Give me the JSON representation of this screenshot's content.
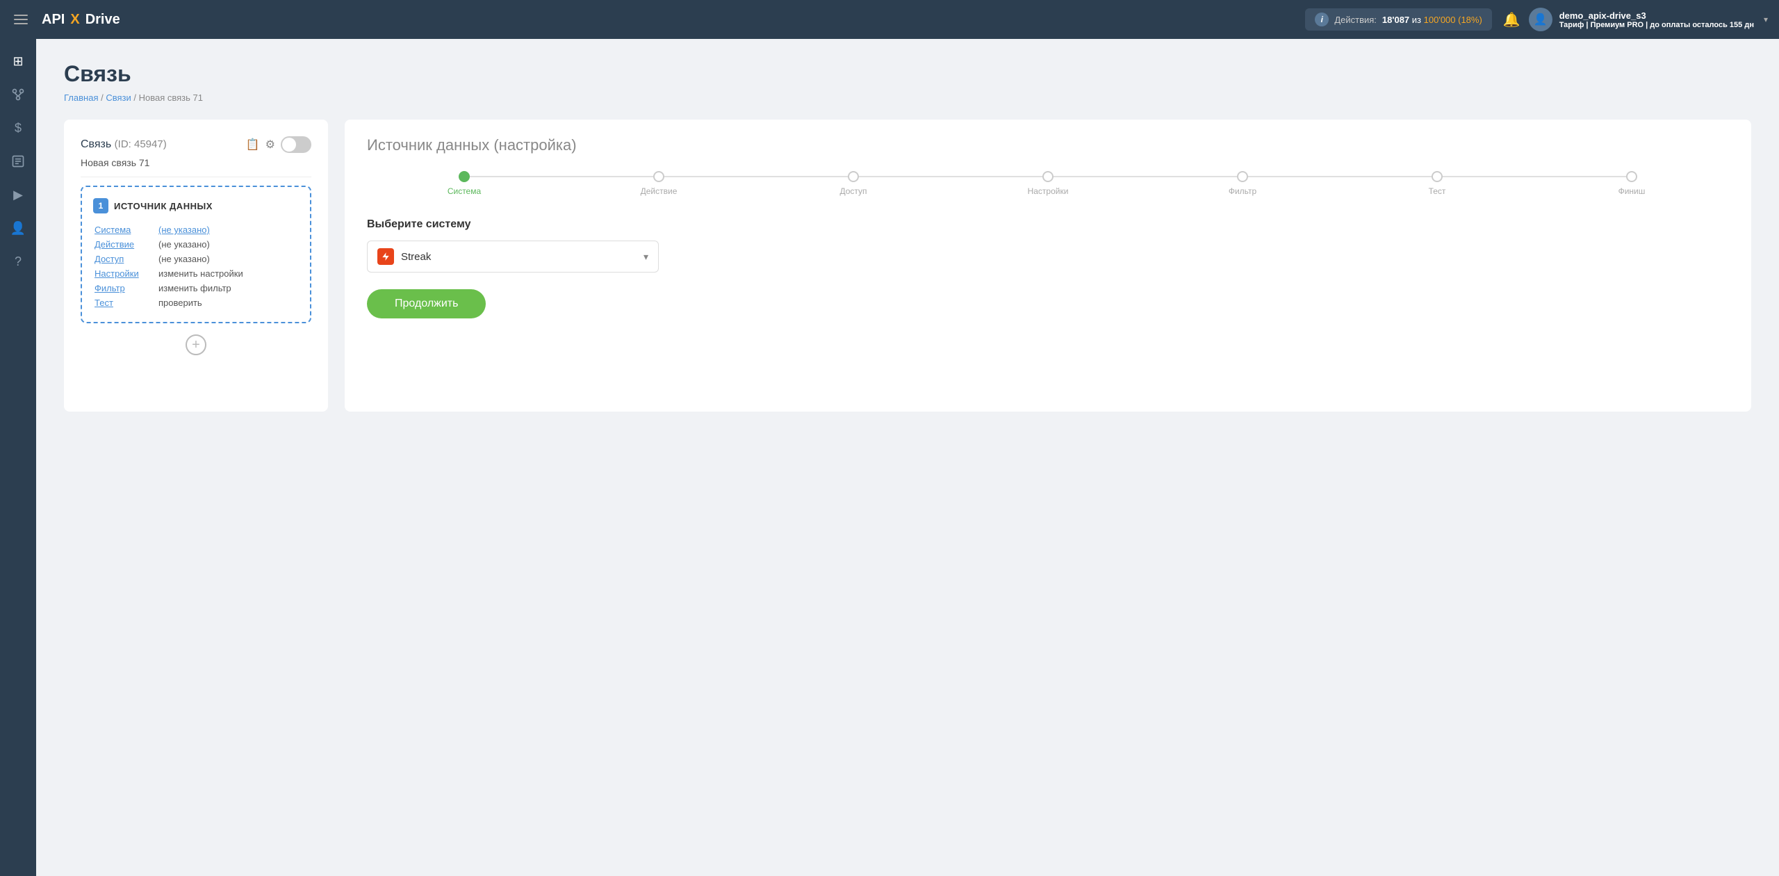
{
  "header": {
    "logo": {
      "api": "API",
      "x": "X",
      "drive": "Drive"
    },
    "actions": {
      "label": "Действия:",
      "count": "18'087",
      "separator": " из ",
      "limit": "100'000 (18%)"
    },
    "bell_label": "🔔",
    "user": {
      "name": "demo_apix-drive_s3",
      "plan_prefix": "Тариф |",
      "plan": "Премиум PRO",
      "plan_suffix": "| до оплаты осталось",
      "days": "155 дн"
    }
  },
  "sidebar": {
    "items": [
      {
        "icon": "⊞",
        "name": "home"
      },
      {
        "icon": "⬡",
        "name": "connections"
      },
      {
        "icon": "$",
        "name": "billing"
      },
      {
        "icon": "🗂",
        "name": "tasks"
      },
      {
        "icon": "▶",
        "name": "video"
      },
      {
        "icon": "👤",
        "name": "profile"
      },
      {
        "icon": "?",
        "name": "help"
      }
    ]
  },
  "page": {
    "title": "Связь",
    "breadcrumb": {
      "home": "Главная",
      "connections": "Связи",
      "current": "Новая связь 71"
    }
  },
  "left_card": {
    "title": "Связь",
    "id_label": "(ID: 45947)",
    "connection_name": "Новая связь 71",
    "source_box": {
      "number": "1",
      "label": "ИСТОЧНИК ДАННЫХ",
      "rows": [
        {
          "key": "Система",
          "value": "(не указано)",
          "value_type": "link"
        },
        {
          "key": "Действие",
          "value": "(не указано)",
          "value_type": "plain"
        },
        {
          "key": "Доступ",
          "value": "(не указано)",
          "value_type": "plain"
        },
        {
          "key": "Настройки",
          "value": "изменить настройки",
          "value_type": "plain"
        },
        {
          "key": "Фильтр",
          "value": "изменить фильтр",
          "value_type": "plain"
        },
        {
          "key": "Тест",
          "value": "проверить",
          "value_type": "plain"
        }
      ]
    },
    "add_button": "+"
  },
  "right_card": {
    "title": "Источник данных",
    "title_suffix": "(настройка)",
    "steps": [
      {
        "label": "Система",
        "active": true
      },
      {
        "label": "Действие",
        "active": false
      },
      {
        "label": "Доступ",
        "active": false
      },
      {
        "label": "Настройки",
        "active": false
      },
      {
        "label": "Фильтр",
        "active": false
      },
      {
        "label": "Тест",
        "active": false
      },
      {
        "label": "Финиш",
        "active": false
      }
    ],
    "select_system_label": "Выберите систему",
    "selected_system": "Streak",
    "continue_button": "Продолжить"
  }
}
